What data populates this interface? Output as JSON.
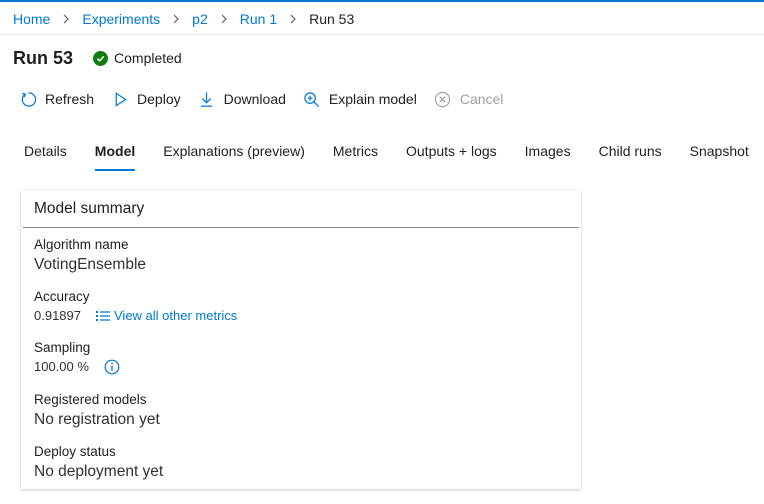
{
  "breadcrumb": {
    "items": [
      "Home",
      "Experiments",
      "p2",
      "Run 1"
    ],
    "current": "Run 53"
  },
  "header": {
    "title": "Run 53",
    "status": "Completed",
    "status_color": "#107c10"
  },
  "toolbar": {
    "refresh": "Refresh",
    "deploy": "Deploy",
    "download": "Download",
    "explain": "Explain model",
    "cancel": "Cancel"
  },
  "tabs": [
    "Details",
    "Model",
    "Explanations (preview)",
    "Metrics",
    "Outputs + logs",
    "Images",
    "Child runs",
    "Snapshot"
  ],
  "active_tab": "Model",
  "colors": {
    "accent": "#0078d4",
    "success": "#107c10",
    "disabled": "#a19f9d"
  },
  "summary": {
    "title": "Model summary",
    "algorithm_label": "Algorithm name",
    "algorithm_value": "VotingEnsemble",
    "accuracy_label": "Accuracy",
    "accuracy_value": "0.91897",
    "metrics_link": "View all other metrics",
    "sampling_label": "Sampling",
    "sampling_value": "100.00 %",
    "registered_label": "Registered models",
    "registered_value": "No registration yet",
    "deploy_label": "Deploy status",
    "deploy_value": "No deployment yet"
  }
}
